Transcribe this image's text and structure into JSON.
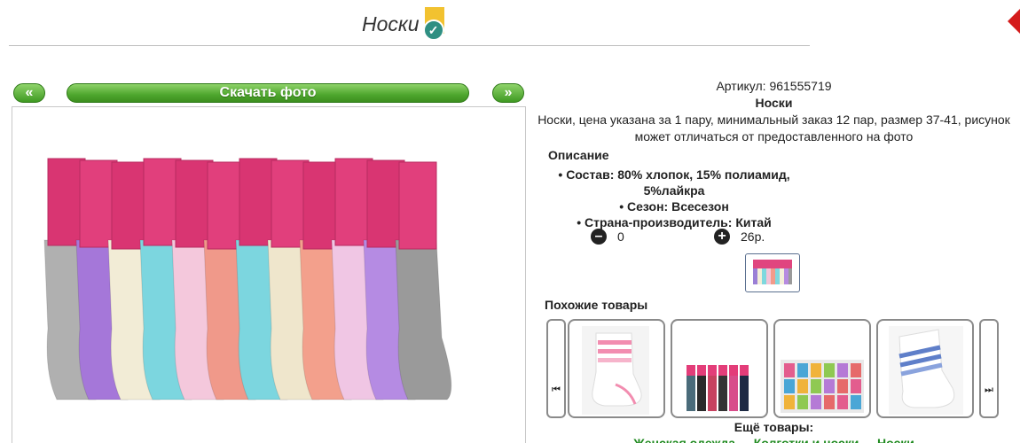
{
  "header": {
    "title": "Носки",
    "verified_icon": "verified-check-icon"
  },
  "photo_bar": {
    "prev_label": "«",
    "download_label": "Скачать фото",
    "next_label": "»"
  },
  "product": {
    "article_label": "Артикул:",
    "article_value": "961555719",
    "name": "Носки",
    "description": "Носки, цена указана за 1 пару, минимальный заказ 12 пар, размер 37-41, рисунок может отличаться от предоставленного на фото",
    "description_heading": "Описание",
    "properties": [
      "Состав: 80% хлопок, 15% полиамид, 5%лайкра",
      "Сезон: Всесезон",
      "Страна-производитель: Китай"
    ],
    "quantity": "0",
    "price": "26р."
  },
  "similar": {
    "heading": "Похожие товары",
    "left_arrow": "⏮",
    "right_arrow": "⏭"
  },
  "more": {
    "heading": "Ещё товары:",
    "links": [
      "Женская одежда",
      "Колготки и носки",
      "Носки"
    ],
    "separator": "-"
  },
  "colors": {
    "button_green": "#4ea62e",
    "link_green": "#1f8a1f"
  }
}
